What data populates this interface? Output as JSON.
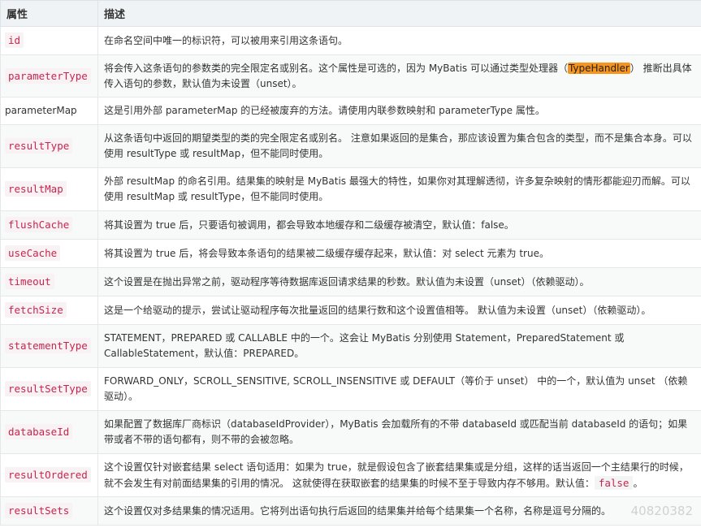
{
  "header": {
    "col1": "属性",
    "col2": "描述"
  },
  "rows": [
    {
      "name": "id",
      "desc": "在命名空间中唯一的标识符，可以被用来引用这条语句。"
    },
    {
      "name": "parameterType",
      "desc_pre": "将会传入这条语句的参数类的完全限定名或别名。这个属性是可选的，因为 MyBatis 可以通过类型处理器（",
      "desc_highlight": "TypeHandler",
      "desc_post": "） 推断出具体传入语句的参数，默认值为未设置（unset）。"
    },
    {
      "name": "parameterMap",
      "desc": "这是引用外部 parameterMap 的已经被废弃的方法。请使用内联参数映射和 parameterType 属性。"
    },
    {
      "name": "resultType",
      "desc": "从这条语句中返回的期望类型的类的完全限定名或别名。 注意如果返回的是集合，那应该设置为集合包含的类型，而不是集合本身。可以使用 resultType 或 resultMap，但不能同时使用。"
    },
    {
      "name": "resultMap",
      "desc": "外部 resultMap 的命名引用。结果集的映射是 MyBatis 最强大的特性，如果你对其理解透彻，许多复杂映射的情形都能迎刃而解。可以使用 resultMap 或 resultType，但不能同时使用。"
    },
    {
      "name": "flushCache",
      "desc": "将其设置为 true 后，只要语句被调用，都会导致本地缓存和二级缓存被清空，默认值：false。"
    },
    {
      "name": "useCache",
      "desc": "将其设置为 true 后，将会导致本条语句的结果被二级缓存缓存起来，默认值：对 select 元素为 true。"
    },
    {
      "name": "timeout",
      "desc": "这个设置是在抛出异常之前，驱动程序等待数据库返回请求结果的秒数。默认值为未设置（unset）（依赖驱动）。"
    },
    {
      "name": "fetchSize",
      "desc": "这是一个给驱动的提示，尝试让驱动程序每次批量返回的结果行数和这个设置值相等。 默认值为未设置（unset）（依赖驱动）。"
    },
    {
      "name": "statementType",
      "desc": "STATEMENT，PREPARED 或 CALLABLE 中的一个。这会让 MyBatis 分别使用 Statement，PreparedStatement 或 CallableStatement，默认值：PREPARED。"
    },
    {
      "name": "resultSetType",
      "desc": "FORWARD_ONLY，SCROLL_SENSITIVE, SCROLL_INSENSITIVE 或 DEFAULT（等价于 unset） 中的一个，默认值为 unset （依赖驱动）。"
    },
    {
      "name": "databaseId",
      "desc": "如果配置了数据库厂商标识（databaseIdProvider），MyBatis 会加载所有的不带 databaseId 或匹配当前 databaseId 的语句；如果带或者不带的语句都有，则不带的会被忽略。"
    },
    {
      "name": "resultOrdered",
      "desc_pre": "这个设置仅针对嵌套结果 select 语句适用：如果为 true，就是假设包含了嵌套结果集或是分组，这样的话当返回一个主结果行的时候，就不会发生有对前面结果集的引用的情况。 这就使得在获取嵌套的结果集的时候不至于导致内存不够用。默认值：",
      "desc_code": "false",
      "desc_post": "。"
    },
    {
      "name": "resultSets",
      "desc": "这个设置仅对多结果集的情况适用。它将列出语句执行后返回的结果集并给每个结果集一个名称，名称是逗号分隔的。"
    }
  ],
  "watermark": "40820382"
}
